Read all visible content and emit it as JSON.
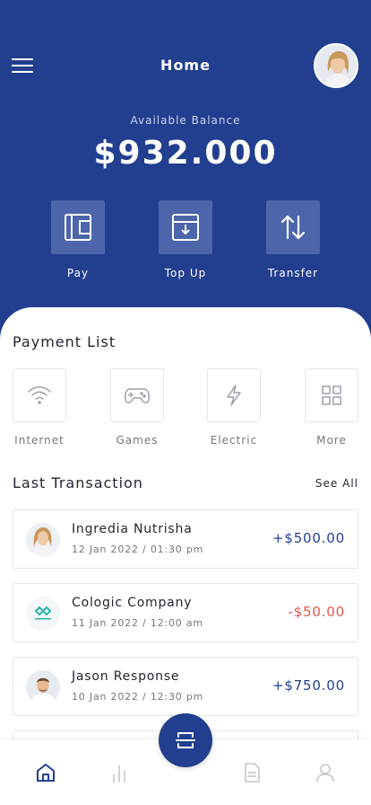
{
  "header": {
    "title": "Home",
    "menu_icon": "hamburger-menu-icon",
    "avatar": "profile-avatar"
  },
  "balance": {
    "label": "Available Balance",
    "value": "$932.000"
  },
  "actions": [
    {
      "label": "Pay",
      "icon": "wallet-icon"
    },
    {
      "label": "Top Up",
      "icon": "top-up-icon"
    },
    {
      "label": "Transfer",
      "icon": "transfer-arrows-icon"
    }
  ],
  "payment_list": {
    "title": "Payment List",
    "items": [
      {
        "label": "Internet",
        "icon": "wifi-icon"
      },
      {
        "label": "Games",
        "icon": "gamepad-icon"
      },
      {
        "label": "Electric",
        "icon": "lightning-icon"
      },
      {
        "label": "More",
        "icon": "grid-icon"
      }
    ]
  },
  "transactions": {
    "title": "Last Transaction",
    "see_all": "See All",
    "items": [
      {
        "name": "Ingredia Nutrisha",
        "date": "12 Jan 2022 / 01:30 pm",
        "amount": "+$500.00",
        "type": "credit"
      },
      {
        "name": "Cologic Company",
        "date": "11 Jan 2022 / 12:00 am",
        "amount": "-$50.00",
        "type": "debit"
      },
      {
        "name": "Jason Response",
        "date": "10 Jan 2022 / 12:30 pm",
        "amount": "+$750.00",
        "type": "credit"
      }
    ]
  },
  "bottom_nav": [
    {
      "icon": "home-icon",
      "active": true
    },
    {
      "icon": "stats-icon",
      "active": false
    },
    {
      "icon": "scan-icon",
      "active": false
    },
    {
      "icon": "document-icon",
      "active": false
    },
    {
      "icon": "profile-icon",
      "active": false
    }
  ],
  "colors": {
    "primary": "#223f8f",
    "tile": "#4c65ab",
    "positive": "#223f8f",
    "negative": "#e2574c",
    "border": "#e3e6ec"
  }
}
